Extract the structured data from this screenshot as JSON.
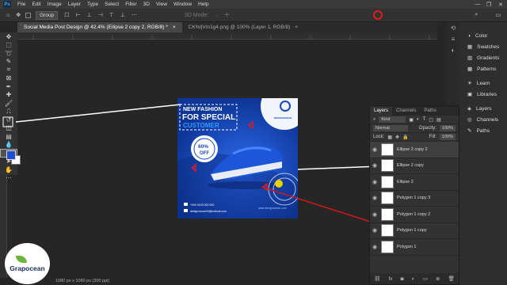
{
  "app": {
    "logo_text": "Ps"
  },
  "menu": [
    "File",
    "Edit",
    "Image",
    "Layer",
    "Type",
    "Select",
    "Filter",
    "3D",
    "View",
    "Window",
    "Help"
  ],
  "window_controls": [
    "—",
    "❐",
    "✕"
  ],
  "options_bar": {
    "mode_select": "Group",
    "mode_3d_label": "3D Mode:"
  },
  "document_tabs": [
    {
      "label": "Social Media Post Design @ 42.4% (Ellipse 2 copy 2, RGB/8) *",
      "close": "×"
    },
    {
      "label": "CK%ljVm1g4.png @ 100% (Layer 1, RGB/8)",
      "close": "×"
    }
  ],
  "design": {
    "headline_1": "NEW FASHION",
    "headline_2": "FOR SPECIAL",
    "headline_3": "CUSTOMER",
    "offer_percent": "60%",
    "offer_word": "OFF",
    "brand_name": "DESIGNOCEAN",
    "website": "www.designocean.com",
    "phone": "+000 0100 000 000",
    "email": "designocean24@outlook.com"
  },
  "right_dock": {
    "group1": [
      "Color",
      "Swatches",
      "Gradients",
      "Patterns"
    ],
    "group2": [
      "Learn",
      "Libraries"
    ],
    "group3": [
      "Layers",
      "Channels",
      "Paths"
    ]
  },
  "layers_panel": {
    "tabs": [
      "Layers",
      "Channels",
      "Paths"
    ],
    "filter_select": "Kind",
    "blend_mode": "Normal",
    "opacity_label": "Opacity:",
    "opacity_value": "100%",
    "lock_label": "Lock:",
    "fill_label": "Fill:",
    "fill_value": "100%",
    "layers": [
      {
        "name": "Ellipse 2 copy 2",
        "selected": true
      },
      {
        "name": "Ellipse 2 copy",
        "selected": false
      },
      {
        "name": "Ellipse 2",
        "selected": false
      },
      {
        "name": "Polygon 1 copy 3",
        "selected": false
      },
      {
        "name": "Polygon 1 copy 2",
        "selected": false
      },
      {
        "name": "Polygon 1 copy",
        "selected": false
      },
      {
        "name": "Polygon 1",
        "selected": false
      }
    ],
    "bottom_icons": [
      "link-icon",
      "fx-icon",
      "mask-icon",
      "adjustment-icon",
      "group-icon",
      "new-layer-icon",
      "trash-icon"
    ],
    "fx_label": "fx"
  },
  "status_bar": {
    "doc_size": "1080 px x 1080 px (300 ppi)"
  },
  "watermark": {
    "text": "Grapocean"
  },
  "colors": {
    "canvas_blue": "#1447c4",
    "highlight_white": "#ffffff",
    "highlight_red": "#d01818",
    "record_red": "#e01b1b"
  }
}
